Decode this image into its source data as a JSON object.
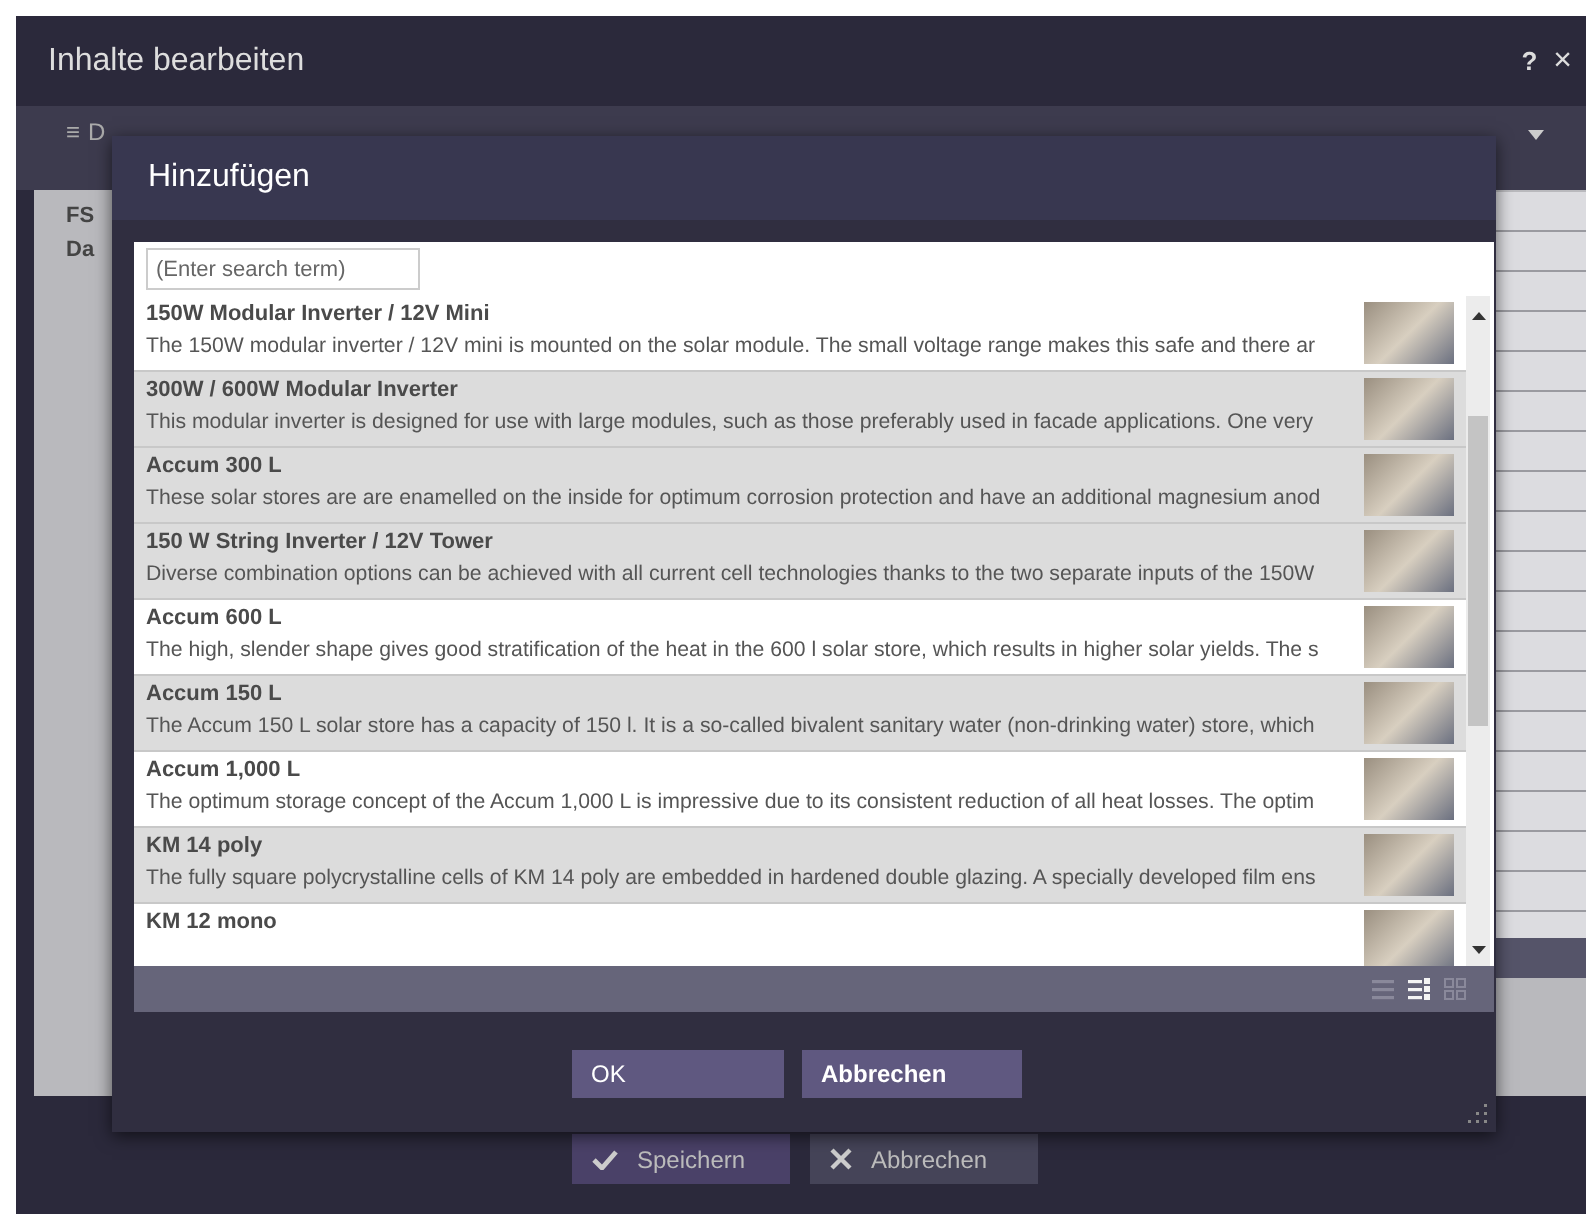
{
  "window": {
    "title": "Inhalte bearbeiten",
    "help": "?",
    "close": "×"
  },
  "tab": {
    "icon": "≡",
    "label": "D"
  },
  "form": {
    "labels": [
      "FS",
      "Da"
    ]
  },
  "dialog": {
    "title": "Hinzufügen",
    "search": {
      "placeholder": "(Enter search term)"
    },
    "items": [
      {
        "title": "150W Modular Inverter / 12V Mini",
        "description": "The 150W modular inverter / 12V mini is mounted on the solar module. The small voltage range makes this safe and there ar",
        "selected": false
      },
      {
        "title": "300W / 600W Modular Inverter",
        "description": "This modular inverter is designed for use with large modules, such as those preferably used in facade applications. One very",
        "selected": true
      },
      {
        "title": "Accum 300 L",
        "description": "These solar stores are are enamelled on the inside for optimum corrosion protection and have an additional magnesium anod",
        "selected": true
      },
      {
        "title": "150 W String Inverter / 12V Tower",
        "description": "Diverse combination options can be achieved with all current cell technologies thanks to the two separate inputs of the 150W",
        "selected": true
      },
      {
        "title": "Accum 600 L",
        "description": "The high, slender shape gives good stratification of the heat in the 600 l solar store, which results in higher solar yields. The s",
        "selected": false
      },
      {
        "title": "Accum 150 L",
        "description": "The Accum 150 L solar store has a capacity of 150 l. It is a so-called bivalent sanitary water (non-drinking water) store, which",
        "selected": true
      },
      {
        "title": "Accum 1,000 L",
        "description": "The optimum storage concept of the Accum 1,000 L is impressive due to its consistent reduction of all heat losses. The optim",
        "selected": false
      },
      {
        "title": "KM 14 poly",
        "description": "The fully square polycrystalline cells of KM 14 poly are embedded in hardened double glazing. A specially developed film ens",
        "selected": true
      },
      {
        "title": "KM 12 mono",
        "selected": false
      }
    ],
    "view_modes": [
      {
        "kind": "list",
        "selected": false
      },
      {
        "kind": "detail",
        "selected": true
      },
      {
        "kind": "grid",
        "selected": false
      }
    ],
    "buttons": [
      "OK",
      "Abbrechen"
    ]
  },
  "footer_buttons": [
    {
      "kind": "save",
      "label": "Speichern"
    },
    {
      "kind": "cancel",
      "label": "Abbrechen"
    }
  ]
}
